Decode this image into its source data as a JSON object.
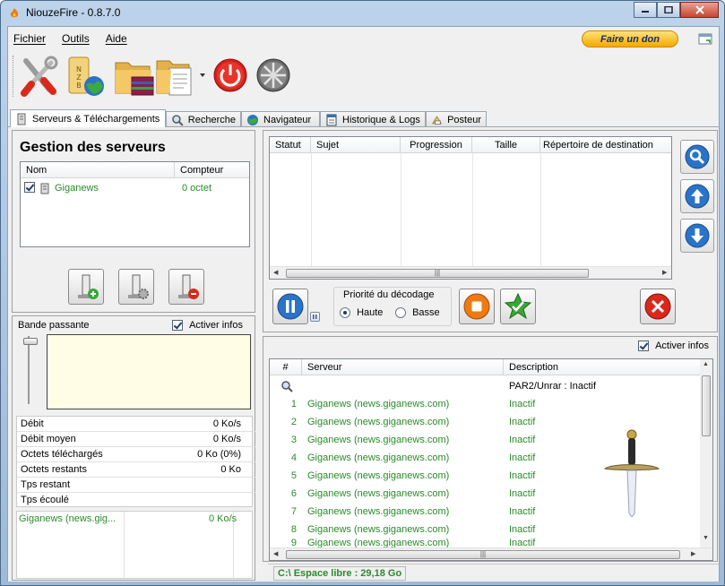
{
  "window": {
    "title": "NiouzeFire - 0.8.7.0"
  },
  "menu": {
    "items": [
      "Fichier",
      "Outils",
      "Aide"
    ],
    "donate_label": "Faire un don"
  },
  "toolbar": {
    "icons": [
      "tools-icon",
      "nzb-globe-icon",
      "folder-archive-icon",
      "folder-document-icon",
      "power-icon",
      "film-reel-icon"
    ]
  },
  "tabs": [
    {
      "label": "Serveurs & Téléchargements",
      "icon": "server-icon",
      "active": true
    },
    {
      "label": "Recherche",
      "icon": "magnifier-icon",
      "active": false
    },
    {
      "label": "Navigateur",
      "icon": "globe-icon",
      "active": false
    },
    {
      "label": "Historique & Logs",
      "icon": "log-icon",
      "active": false
    },
    {
      "label": "Posteur",
      "icon": "poster-icon",
      "active": false
    }
  ],
  "servers": {
    "title": "Gestion des serveurs",
    "columns": [
      "Nom",
      "Compteur"
    ],
    "rows": [
      {
        "name": "Giganews",
        "counter": "0 octet",
        "checked": true
      }
    ]
  },
  "bandwidth": {
    "label": "Bande passante",
    "activer_infos": "Activer infos",
    "stats": [
      {
        "key": "Débit",
        "value": "0 Ko/s"
      },
      {
        "key": "Débit moyen",
        "value": "0 Ko/s"
      },
      {
        "key": "Octets téléchargés",
        "value": "0 Ko (0%)"
      },
      {
        "key": "Octets restants",
        "value": "0 Ko"
      },
      {
        "key": "Tps restant",
        "value": ""
      },
      {
        "key": "Tps écoulé",
        "value": ""
      }
    ],
    "connections": [
      {
        "name": "Giganews (news.gig...",
        "speed": "0 Ko/s"
      }
    ]
  },
  "downloads": {
    "columns": [
      "Statut",
      "Sujet",
      "Progression",
      "Taille",
      "Répertoire de destination"
    ],
    "decoding_priority": {
      "label": "Priorité du décodage",
      "options": [
        "Haute",
        "Basse"
      ],
      "selected": "Haute"
    }
  },
  "connections_panel": {
    "activer_infos": "Activer infos",
    "columns": [
      "#",
      "Serveur",
      "Description"
    ],
    "search_row_description": "PAR2/Unrar : Inactif",
    "rows": [
      {
        "n": "1",
        "server": "Giganews (news.giganews.com)",
        "desc": "Inactif"
      },
      {
        "n": "2",
        "server": "Giganews (news.giganews.com)",
        "desc": "Inactif"
      },
      {
        "n": "3",
        "server": "Giganews (news.giganews.com)",
        "desc": "Inactif"
      },
      {
        "n": "4",
        "server": "Giganews (news.giganews.com)",
        "desc": "Inactif"
      },
      {
        "n": "5",
        "server": "Giganews (news.giganews.com)",
        "desc": "Inactif"
      },
      {
        "n": "6",
        "server": "Giganews (news.giganews.com)",
        "desc": "Inactif"
      },
      {
        "n": "7",
        "server": "Giganews (news.giganews.com)",
        "desc": "Inactif"
      },
      {
        "n": "8",
        "server": "Giganews (news.giganews.com)",
        "desc": "Inactif"
      },
      {
        "n": "9",
        "server": "Giganews (news.giganews.com)",
        "desc": "Inactif"
      }
    ]
  },
  "status": {
    "free_space": "C:\\ Espace libre : 29,18 Go"
  },
  "colors": {
    "green_text": "#2b8a2b",
    "donate": "#f5a800",
    "accent_blue": "#2a73c8"
  }
}
